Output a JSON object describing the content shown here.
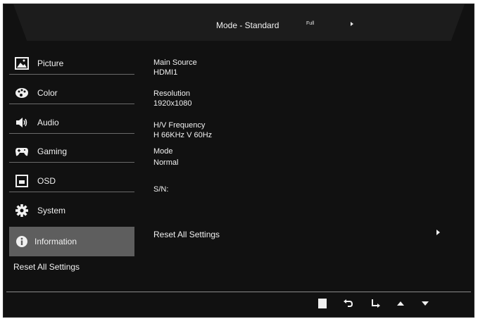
{
  "header": {
    "mode_label": "Mode - Standard",
    "full_label": "Full"
  },
  "sidebar": {
    "items": [
      {
        "label": "Picture",
        "icon": "picture-icon"
      },
      {
        "label": "Color",
        "icon": "palette-icon"
      },
      {
        "label": "Audio",
        "icon": "speaker-icon"
      },
      {
        "label": "Gaming",
        "icon": "gamepad-icon"
      },
      {
        "label": "OSD",
        "icon": "osd-icon"
      },
      {
        "label": "System",
        "icon": "gear-icon"
      },
      {
        "label": "Information",
        "icon": "info-icon",
        "active": true
      }
    ],
    "reset_label": "Reset All Settings"
  },
  "info": {
    "main_source_label": "Main Source",
    "main_source_value": "HDMI1",
    "resolution_label": "Resolution",
    "resolution_value": "1920x1080",
    "hv_frequency_label": "H/V Frequency",
    "hv_frequency_value": "H 66KHz V 60Hz",
    "mode_label": "Mode",
    "mode_value": "Normal",
    "sn_label": "S/N:"
  },
  "main": {
    "reset_label": "Reset All Settings"
  },
  "footer": {
    "buttons": [
      "stop-icon",
      "return-icon",
      "enter-icon",
      "up-arrow-icon",
      "down-arrow-icon"
    ]
  },
  "colors": {
    "background": "#111111",
    "header": "#1c1c1c",
    "active_item": "#5e5e5e",
    "text": "#f0f0f0",
    "divider": "#6a6a6a"
  }
}
